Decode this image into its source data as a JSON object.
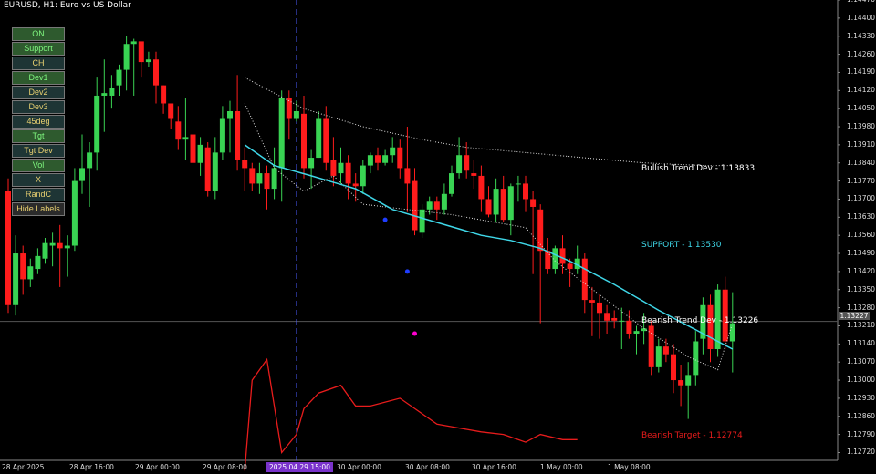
{
  "window": {
    "title": "EURUSD, H1:  Euro vs US Dollar"
  },
  "panel": {
    "buttons": [
      {
        "label": "ON",
        "state": "active"
      },
      {
        "label": "Support",
        "state": "active"
      },
      {
        "label": "CH",
        "state": "inactive"
      },
      {
        "label": "Dev1",
        "state": "active"
      },
      {
        "label": "Dev2",
        "state": "inactive"
      },
      {
        "label": "Dev3",
        "state": "inactive"
      },
      {
        "label": "45deg",
        "state": "inactive"
      },
      {
        "label": "Tgt",
        "state": "active"
      },
      {
        "label": "Tgt Dev",
        "state": "inactive"
      },
      {
        "label": "Vol",
        "state": "active"
      },
      {
        "label": "X",
        "state": "inactive"
      },
      {
        "label": "RandC",
        "state": "inactive"
      },
      {
        "label": "Hide Labels",
        "state": "hl"
      }
    ]
  },
  "colors": {
    "bull": "#39d353",
    "bear": "#ff1c1c",
    "support": "#3fd7e8",
    "dev": "#dddddd",
    "target": "#e81c1c",
    "cursor": "#4d5cff",
    "text": "#dddddd"
  },
  "levels": {
    "bullish_dev": "Bullish Trend Dev - 1.13833",
    "support": "SUPPORT - 1.13530",
    "bearish_dev": "Bearish Trend Dev - 1.13226",
    "bearish_target": "Bearish Target - 1.12774"
  },
  "current_price": "1.13227",
  "cursor_time": "2025.04.29 15:00",
  "chart_data": {
    "type": "candlestick",
    "symbol": "EURUSD",
    "timeframe": "H1",
    "y_ticks": [
      "1.14470",
      "1.14400",
      "1.14330",
      "1.14260",
      "1.14190",
      "1.14120",
      "1.14050",
      "1.13980",
      "1.13910",
      "1.13840",
      "1.13770",
      "1.13700",
      "1.13630",
      "1.13560",
      "1.13490",
      "1.13420",
      "1.13350",
      "1.13280",
      "1.13210",
      "1.13140",
      "1.13070",
      "1.13000",
      "1.12930",
      "1.12860",
      "1.12790",
      "1.12720"
    ],
    "ylim": [
      1.1269,
      1.1447
    ],
    "x_ticks": [
      "28 Apr 2025",
      "28 Apr 16:00",
      "29 Apr 00:00",
      "29 Apr 08:00",
      "30 Apr 00:00",
      "30 Apr 08:00",
      "30 Apr 16:00",
      "1 May 00:00",
      "1 May 08:00"
    ],
    "candles": [
      [
        1.1373,
        1.1329,
        1.1378,
        1.1326
      ],
      [
        1.1329,
        1.1349,
        1.1356,
        1.1325
      ],
      [
        1.1349,
        1.1339,
        1.1352,
        1.1333
      ],
      [
        1.1339,
        1.1344,
        1.1347,
        1.1336
      ],
      [
        1.1343,
        1.1348,
        1.1351,
        1.1341
      ],
      [
        1.1347,
        1.1353,
        1.1355,
        1.1345
      ],
      [
        1.1352,
        1.1353,
        1.1357,
        1.1344
      ],
      [
        1.1353,
        1.1351,
        1.136,
        1.1336
      ],
      [
        1.1351,
        1.1352,
        1.1356,
        1.134
      ],
      [
        1.1352,
        1.1377,
        1.1382,
        1.135
      ],
      [
        1.1377,
        1.1382,
        1.1395,
        1.1372
      ],
      [
        1.1382,
        1.1388,
        1.1392,
        1.1367
      ],
      [
        1.1388,
        1.141,
        1.1417,
        1.1381
      ],
      [
        1.141,
        1.1411,
        1.1424,
        1.1396
      ],
      [
        1.141,
        1.1413,
        1.1418,
        1.1405
      ],
      [
        1.1414,
        1.142,
        1.1422,
        1.141
      ],
      [
        1.142,
        1.143,
        1.1433,
        1.1412
      ],
      [
        1.143,
        1.1431,
        1.1432,
        1.141
      ],
      [
        1.1431,
        1.1423,
        1.1427,
        1.1417
      ],
      [
        1.1423,
        1.1424,
        1.1427,
        1.1421
      ],
      [
        1.1424,
        1.1414,
        1.1427,
        1.1407
      ],
      [
        1.1414,
        1.1407,
        1.1414,
        1.1403
      ],
      [
        1.1407,
        1.1401,
        1.1406,
        1.1397
      ],
      [
        1.14,
        1.1393,
        1.1406,
        1.1389
      ],
      [
        1.1393,
        1.1394,
        1.1409,
        1.1385
      ],
      [
        1.1395,
        1.1384,
        1.1407,
        1.1371
      ],
      [
        1.1384,
        1.1391,
        1.1394,
        1.1379
      ],
      [
        1.139,
        1.1373,
        1.1392,
        1.1371
      ],
      [
        1.1373,
        1.1388,
        1.1394,
        1.137
      ],
      [
        1.1388,
        1.1401,
        1.1406,
        1.1385
      ],
      [
        1.1401,
        1.1404,
        1.1408,
        1.1388
      ],
      [
        1.1404,
        1.1385,
        1.1418,
        1.1381
      ],
      [
        1.1385,
        1.1382,
        1.139,
        1.1373
      ],
      [
        1.1382,
        1.1376,
        1.1384,
        1.1373
      ],
      [
        1.1376,
        1.138,
        1.1384,
        1.1372
      ],
      [
        1.138,
        1.1374,
        1.1383,
        1.1366
      ],
      [
        1.1374,
        1.1382,
        1.139,
        1.137
      ],
      [
        1.1382,
        1.1409,
        1.1412,
        1.1369
      ],
      [
        1.1409,
        1.1401,
        1.1412,
        1.1393
      ],
      [
        1.1401,
        1.1404,
        1.1408,
        1.14
      ],
      [
        1.1403,
        1.1382,
        1.141,
        1.1378
      ],
      [
        1.1382,
        1.1386,
        1.1389,
        1.1374
      ],
      [
        1.1386,
        1.1401,
        1.1404,
        1.1386
      ],
      [
        1.1401,
        1.1384,
        1.1406,
        1.1381
      ],
      [
        1.1385,
        1.1379,
        1.1394,
        1.1375
      ],
      [
        1.138,
        1.1384,
        1.139,
        1.1376
      ],
      [
        1.1384,
        1.1376,
        1.1387,
        1.137
      ],
      [
        1.1376,
        1.1375,
        1.138,
        1.1369
      ],
      [
        1.1375,
        1.1383,
        1.1385,
        1.1372
      ],
      [
        1.1383,
        1.1387,
        1.1388,
        1.138
      ],
      [
        1.1387,
        1.1384,
        1.139,
        1.1381
      ],
      [
        1.1384,
        1.1387,
        1.1389,
        1.1383
      ],
      [
        1.1387,
        1.139,
        1.1394,
        1.1384
      ],
      [
        1.139,
        1.1382,
        1.1393,
        1.1378
      ],
      [
        1.1382,
        1.1376,
        1.1398,
        1.1365
      ],
      [
        1.1377,
        1.1358,
        1.1382,
        1.1356
      ],
      [
        1.1357,
        1.1366,
        1.1368,
        1.1355
      ],
      [
        1.1366,
        1.1369,
        1.1371,
        1.1364
      ],
      [
        1.1369,
        1.1366,
        1.1371,
        1.1362
      ],
      [
        1.1366,
        1.1372,
        1.1376,
        1.1364
      ],
      [
        1.1372,
        1.138,
        1.1383,
        1.1371
      ],
      [
        1.138,
        1.1387,
        1.1394,
        1.1378
      ],
      [
        1.1387,
        1.1381,
        1.1392,
        1.1378
      ],
      [
        1.138,
        1.1379,
        1.1385,
        1.1374
      ],
      [
        1.1379,
        1.137,
        1.1383,
        1.1365
      ],
      [
        1.137,
        1.1364,
        1.1375,
        1.1363
      ],
      [
        1.1364,
        1.1374,
        1.1378,
        1.1361
      ],
      [
        1.1374,
        1.1362,
        1.1379,
        1.1361
      ],
      [
        1.1362,
        1.1375,
        1.1376,
        1.1356
      ],
      [
        1.1376,
        1.1376,
        1.1379,
        1.1369
      ],
      [
        1.1376,
        1.137,
        1.1379,
        1.1365
      ],
      [
        1.137,
        1.1367,
        1.1373,
        1.1341
      ],
      [
        1.1366,
        1.135,
        1.1368,
        1.1322
      ],
      [
        1.135,
        1.1343,
        1.1355,
        1.1341
      ],
      [
        1.1343,
        1.1351,
        1.1352,
        1.1341
      ],
      [
        1.1351,
        1.1345,
        1.1356,
        1.1341
      ],
      [
        1.1345,
        1.1343,
        1.1347,
        1.1336
      ],
      [
        1.1343,
        1.1347,
        1.1352,
        1.1341
      ],
      [
        1.1347,
        1.1331,
        1.1349,
        1.1326
      ],
      [
        1.1331,
        1.133,
        1.1336,
        1.1317
      ],
      [
        1.133,
        1.1326,
        1.1333,
        1.1316
      ],
      [
        1.1326,
        1.1323,
        1.1329,
        1.1318
      ],
      [
        1.1324,
        1.1323,
        1.1327,
        1.132
      ],
      [
        1.1323,
        1.1323,
        1.1328,
        1.1312
      ],
      [
        1.1323,
        1.1318,
        1.1327,
        1.1316
      ],
      [
        1.1318,
        1.1319,
        1.1321,
        1.131
      ],
      [
        1.1319,
        1.132,
        1.1326,
        1.1314
      ],
      [
        1.1321,
        1.1305,
        1.1323,
        1.1302
      ],
      [
        1.1305,
        1.1313,
        1.1316,
        1.1303
      ],
      [
        1.1313,
        1.131,
        1.1316,
        1.1307
      ],
      [
        1.131,
        1.13,
        1.1314,
        1.1295
      ],
      [
        1.13,
        1.1298,
        1.1306,
        1.129
      ],
      [
        1.1298,
        1.1302,
        1.1307,
        1.1285
      ],
      [
        1.1302,
        1.1315,
        1.1319,
        1.1298
      ],
      [
        1.1316,
        1.1329,
        1.1332,
        1.131
      ],
      [
        1.1329,
        1.1312,
        1.1333,
        1.1307
      ],
      [
        1.1312,
        1.1335,
        1.1337,
        1.1309
      ],
      [
        1.1335,
        1.1315,
        1.134,
        1.1312
      ],
      [
        1.1315,
        1.1322,
        1.1334,
        1.1303
      ]
    ],
    "support_line": [
      [
        32,
        1.1391
      ],
      [
        36,
        1.1383
      ],
      [
        41,
        1.1379
      ],
      [
        47,
        1.1374
      ],
      [
        52,
        1.1366
      ],
      [
        58,
        1.1361
      ],
      [
        64,
        1.1356
      ],
      [
        68,
        1.1354
      ],
      [
        72,
        1.1351
      ],
      [
        76,
        1.1346
      ],
      [
        82,
        1.1337
      ],
      [
        88,
        1.1327
      ],
      [
        94,
        1.1318
      ],
      [
        98,
        1.1312
      ]
    ],
    "bullish_dev_line": [
      [
        32,
        1.1417
      ],
      [
        40,
        1.1405
      ],
      [
        48,
        1.1398
      ],
      [
        56,
        1.1393
      ],
      [
        62,
        1.139
      ],
      [
        70,
        1.1388
      ],
      [
        78,
        1.1386
      ],
      [
        86,
        1.1384
      ],
      [
        94,
        1.1383
      ],
      [
        98,
        1.1383
      ]
    ],
    "bearish_dev_line": [
      [
        32,
        1.1407
      ],
      [
        36,
        1.1382
      ],
      [
        40,
        1.1373
      ],
      [
        44,
        1.1379
      ],
      [
        48,
        1.1368
      ],
      [
        54,
        1.1366
      ],
      [
        60,
        1.1364
      ],
      [
        64,
        1.1362
      ],
      [
        70,
        1.1359
      ],
      [
        74,
        1.1346
      ],
      [
        80,
        1.1333
      ],
      [
        86,
        1.132
      ],
      [
        92,
        1.1309
      ],
      [
        96,
        1.1304
      ],
      [
        98,
        1.1322
      ]
    ],
    "bearish_target_line": [
      [
        32,
        1.1265
      ],
      [
        33,
        1.13
      ],
      [
        35,
        1.1308
      ],
      [
        37,
        1.1272
      ],
      [
        39,
        1.1279
      ],
      [
        40,
        1.1289
      ],
      [
        42,
        1.1295
      ],
      [
        45,
        1.1298
      ],
      [
        47,
        1.129
      ],
      [
        49,
        1.129
      ],
      [
        53,
        1.1293
      ],
      [
        56,
        1.1287
      ],
      [
        58,
        1.1283
      ],
      [
        62,
        1.1281
      ],
      [
        64,
        1.128
      ],
      [
        67,
        1.1279
      ],
      [
        70,
        1.1276
      ],
      [
        72,
        1.1279
      ],
      [
        75,
        1.1277
      ],
      [
        77,
        1.1277
      ]
    ],
    "markers": [
      {
        "i": 51,
        "price": 1.1362,
        "color": "#1f3dff"
      },
      {
        "i": 54,
        "price": 1.1342,
        "color": "#1f3dff"
      },
      {
        "i": 55,
        "price": 1.1318,
        "color": "#ff00d0"
      }
    ]
  }
}
